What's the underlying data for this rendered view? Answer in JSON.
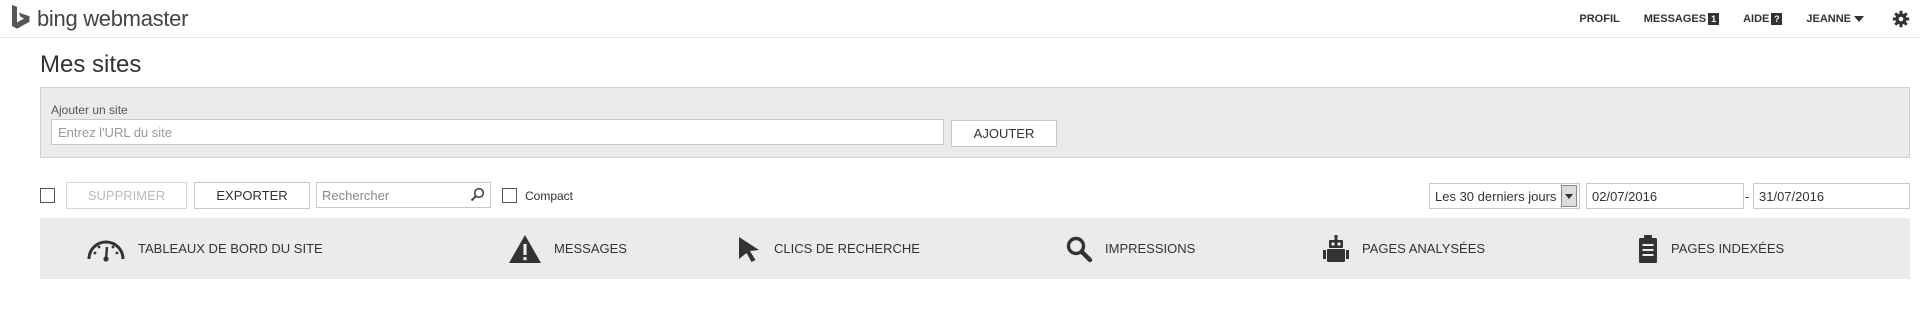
{
  "brand": {
    "name": "bing webmaster",
    "logo_icon": "bing-logo-icon"
  },
  "nav": {
    "profile": "PROFIL",
    "messages": "MESSAGES",
    "messages_count": "1",
    "help": "AIDE",
    "help_badge": "?",
    "user": "JEANNE",
    "settings_icon": "gear-icon"
  },
  "page": {
    "title": "Mes sites"
  },
  "add_site": {
    "label": "Ajouter un site",
    "placeholder": "Entrez l'URL du site",
    "button": "AJOUTER"
  },
  "toolbar": {
    "delete": "SUPPRIMER",
    "export": "EXPORTER",
    "search_placeholder": "Rechercher",
    "compact": "Compact",
    "period": "Les 30 derniers jours",
    "date_from": "02/07/2016",
    "date_separator": "-",
    "date_to": "31/07/2016"
  },
  "metrics": [
    {
      "label": "TABLEAUX DE BORD DU SITE",
      "icon": "dashboard-gauge-icon"
    },
    {
      "label": "MESSAGES",
      "icon": "warning-icon"
    },
    {
      "label": "CLICS DE RECHERCHE",
      "icon": "cursor-icon"
    },
    {
      "label": "IMPRESSIONS",
      "icon": "search-icon"
    },
    {
      "label": "PAGES ANALYSÉES",
      "icon": "robot-icon"
    },
    {
      "label": "PAGES INDEXÉES",
      "icon": "clipboard-icon"
    }
  ],
  "colors": {
    "panel_bg": "#ebebeb",
    "text": "#333333",
    "border": "#c8c8c8"
  }
}
